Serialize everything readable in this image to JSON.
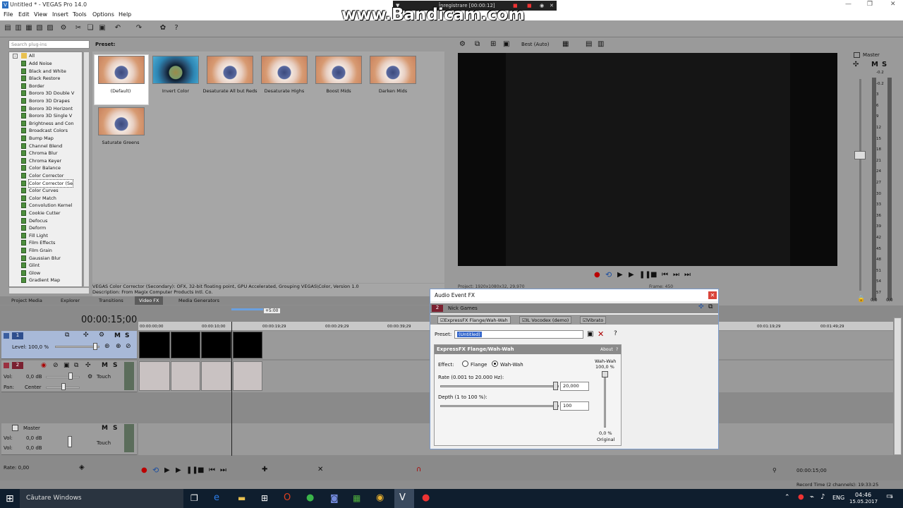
{
  "window": {
    "title": "Untitled * - VEGAS Pro 14.0"
  },
  "menu": [
    "File",
    "Edit",
    "View",
    "Insert",
    "Tools",
    "Options",
    "Help"
  ],
  "overlay": {
    "brand": "www.Bandicam.com",
    "recording": "Înregistrare [00:00:12]"
  },
  "fx_browser": {
    "search_placeholder": "Search plug-ins",
    "preset_heading": "Preset:",
    "root": "All",
    "items": [
      "Add Noise",
      "Black and White",
      "Black Restore",
      "Border",
      "Bororo 3D Double V",
      "Bororo 3D Drapes",
      "Bororo 3D Horizont",
      "Bororo 3D Single V",
      "Brightness and Con",
      "Broadcast Colors",
      "Bump Map",
      "Channel Blend",
      "Chroma Blur",
      "Chroma Keyer",
      "Color Balance",
      "Color Corrector",
      "Color Corrector (Se",
      "Color Curves",
      "Color Match",
      "Convolution Kernel",
      "Cookie Cutter",
      "Defocus",
      "Deform",
      "Fill Light",
      "Film Effects",
      "Film Grain",
      "Gaussian Blur",
      "Glint",
      "Glow",
      "Gradient Map"
    ],
    "selected_index": 16,
    "presets": [
      "(Default)",
      "Invert Color",
      "Desaturate All but Reds",
      "Desaturate Highs",
      "Boost Mids",
      "Darken Mids",
      "Saturate Greens"
    ],
    "description_1": "VEGAS Color Corrector (Secondary): OFX, 32-bit floating point, GPU Accelerated, Grouping VEGAS\\Color, Version 1.0",
    "description_2": "Description: From Magix Computer Products Intl. Co.",
    "tabs": [
      "Project Media",
      "Explorer",
      "Transitions",
      "Video FX",
      "Media Generators"
    ],
    "active_tab": "Video FX"
  },
  "preview": {
    "quality": "Best (Auto)",
    "project": "Project:   1920x1080x32, 29,970",
    "frame": "Frame:   450"
  },
  "mixer": {
    "label": "Master",
    "scale": [
      "-0.2",
      "-0.2",
      "3",
      "6",
      "9",
      "12",
      "15",
      "18",
      "21",
      "24",
      "27",
      "30",
      "33",
      "36",
      "39",
      "42",
      "45",
      "48",
      "51",
      "54",
      "57"
    ],
    "bottom": [
      "0,0",
      "0,0"
    ]
  },
  "timeline": {
    "timecode": "00:00:15;00",
    "ruler": [
      "00:00:00;00",
      "00:00:10;00",
      "00:00:19;29",
      "00:00:29;29",
      "00:00:39;29",
      "00:01:19;29",
      "00:01:49;29"
    ],
    "plus": "+5:00",
    "video_track": {
      "num": "1",
      "level": "Level: 100,0 %"
    },
    "audio_track": {
      "num": "2",
      "vol": "Vol:",
      "vol_val": "0,0 dB",
      "pan": "Pan:",
      "pan_val": "Center",
      "mode": "Touch"
    },
    "master": {
      "label": "Master",
      "vol": "Vol:",
      "vol_val": "0,0 dB",
      "vol2": "Vol:",
      "vol2_val": "0,0 dB",
      "mode": "Touch"
    },
    "rate": "Rate: 0,00",
    "end_time": "00:00:15;00",
    "record_time": "Record Time (2 channels): 19:33:25"
  },
  "dialog": {
    "title": "Audio Event FX",
    "track": "Nick Games",
    "track_num": "2",
    "chain": [
      "ExpressFX Flange/Wah-Wah",
      "IL Vocodex (demo)",
      "Vibrato"
    ],
    "preset_label": "Preset:",
    "preset_value": "(Untitled)",
    "plugin_title": "ExpressFX Flange/Wah-Wah",
    "about": "About",
    "effect_label": "Effect:",
    "opt_flange": "Flange",
    "opt_wah": "Wah-Wah",
    "selected_effect": "Wah-Wah",
    "rate_label": "Rate (0.001 to 20.000 Hz):",
    "rate_value": "20,000",
    "depth_label": "Depth (1 to 100 %):",
    "depth_value": "100",
    "wah_label": "Wah-Wah",
    "wah_top": "100,0 %",
    "wah_bottom": "0,0 %",
    "wah_original": "Original"
  },
  "taskbar": {
    "search": "Căutare Windows",
    "lang": "ENG",
    "time": "04:46",
    "date": "15.05.2017",
    "notif": "5"
  }
}
